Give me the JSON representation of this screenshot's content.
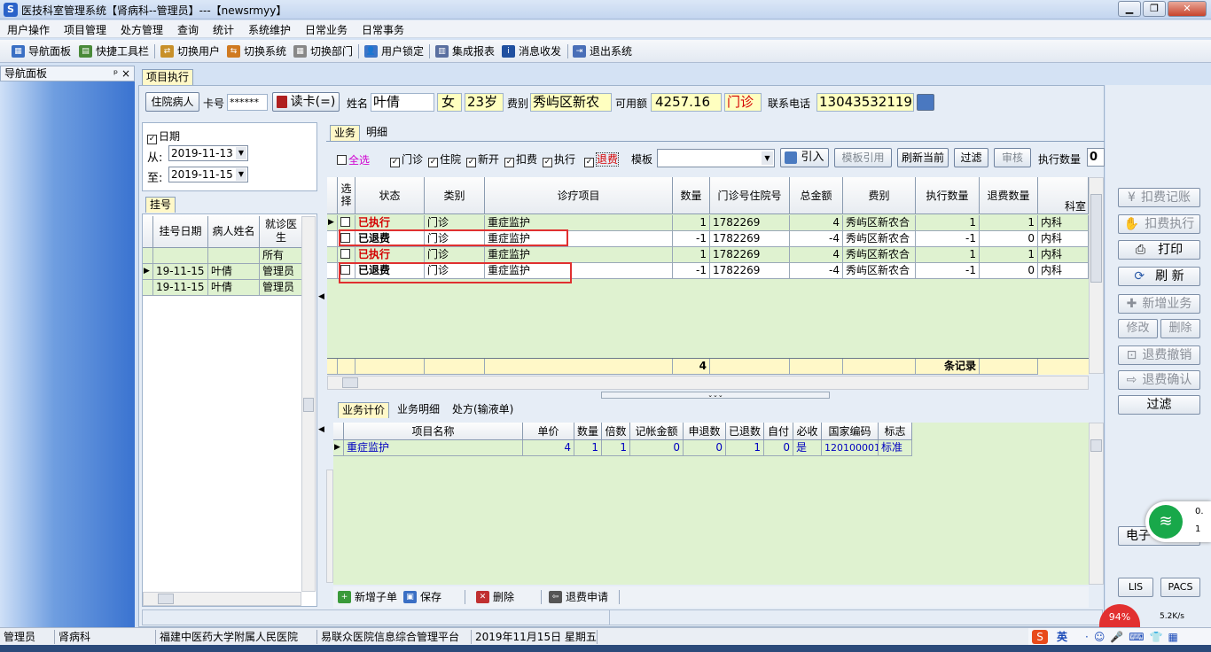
{
  "window": {
    "title": "医技科室管理系统【肾病科--管理员】---【newsrmyy】",
    "logo": "S"
  },
  "menu": [
    "用户操作",
    "项目管理",
    "处方管理",
    "查询",
    "统计",
    "系统维护",
    "日常业务",
    "日常事务"
  ],
  "toolbar": [
    "导航面板",
    "快捷工具栏",
    "切换用户",
    "切换系统",
    "切换部门",
    "用户锁定",
    "集成报表",
    "消息收发",
    "退出系统"
  ],
  "nav": {
    "title": "导航面板",
    "pin": "ᵖ ×"
  },
  "doc_tab": "项目执行",
  "patient": {
    "inpatient_btn": "住院病人",
    "card_label": "卡号",
    "card_value": "******",
    "read_card": "读卡(=)",
    "name_label": "姓名",
    "name": "叶倩",
    "sex": "女",
    "age": "23岁",
    "fee_label": "费别",
    "fee_type": "秀屿区新农",
    "avail_label": "可用额",
    "avail": "4257.16",
    "visit_type": "门诊",
    "phone_label": "联系电话",
    "phone": "13043532119"
  },
  "date_filter": {
    "label": "日期",
    "from_label": "从:",
    "from": "2019-11-13",
    "to_label": "至:",
    "to": "2019-11-15"
  },
  "register": {
    "tab": "挂号",
    "headers": [
      "挂号日期",
      "病人姓名",
      "就诊医生"
    ],
    "all": "所有",
    "rows": [
      [
        "19-11-15",
        "叶倩",
        "管理员"
      ],
      [
        "19-11-15",
        "叶倩",
        "管理员"
      ]
    ]
  },
  "biz_tabs": [
    "业务",
    "明细"
  ],
  "filters": {
    "select_all": "全选",
    "outpatient": "门诊",
    "inpatient": "住院",
    "new": "新开",
    "charge": "扣费",
    "execute": "执行",
    "refund": "退费",
    "template_label": "模板",
    "import": "引入",
    "template_ref": "模板引用",
    "refresh_current": "刷新当前",
    "filter": "过滤",
    "audit": "审核",
    "exec_count_label": "执行数量",
    "exec_count": "0"
  },
  "main_table": {
    "headers": [
      "选择",
      "状态",
      "类别",
      "诊疗项目",
      "数量",
      "门诊号住院号",
      "总金额",
      "费别",
      "执行数量",
      "退费数量",
      "科室"
    ],
    "rows": [
      {
        "status": "已执行",
        "cat": "门诊",
        "item": "重症监护",
        "qty": "1",
        "no": "1782269",
        "amt": "4",
        "fee": "秀屿区新农合",
        "exec": "1",
        "refund": "1",
        "dept": "内科"
      },
      {
        "status": "已退费",
        "cat": "门诊",
        "item": "重症监护",
        "qty": "-1",
        "no": "1782269",
        "amt": "-4",
        "fee": "秀屿区新农合",
        "exec": "-1",
        "refund": "0",
        "dept": "内科"
      },
      {
        "status": "已执行",
        "cat": "门诊",
        "item": "重症监护",
        "qty": "1",
        "no": "1782269",
        "amt": "4",
        "fee": "秀屿区新农合",
        "exec": "1",
        "refund": "1",
        "dept": "内科"
      },
      {
        "status": "已退费",
        "cat": "门诊",
        "item": "重症监护",
        "qty": "-1",
        "no": "1782269",
        "amt": "-4",
        "fee": "秀屿区新农合",
        "exec": "-1",
        "refund": "0",
        "dept": "内科"
      }
    ],
    "footer_count": "4",
    "footer_label": "条记录"
  },
  "detail_tabs": [
    "业务计价",
    "业务明细",
    "处方(输液单)"
  ],
  "detail_table": {
    "headers": [
      "项目名称",
      "单价",
      "数量",
      "倍数",
      "记帐金额",
      "申退数",
      "已退数",
      "自付",
      "必收",
      "国家编码",
      "标志"
    ],
    "row": [
      "重症监护",
      "4",
      "1",
      "1",
      "0",
      "0",
      "1",
      "0",
      "是",
      "120100001",
      "标准"
    ]
  },
  "bottom_actions": [
    "新增子单",
    "保存",
    "删除",
    "退费申请"
  ],
  "right_buttons": [
    "扣费记账",
    "扣费执行",
    "打印",
    "刷 新",
    "新增业务",
    "修改",
    "删除",
    "退费撤销",
    "退费确认",
    "过滤"
  ],
  "right_bottom": {
    "e": "电子",
    "lis": "LIS",
    "pacs": "PACS"
  },
  "net": {
    "up": "0.",
    "down": "1",
    "speed": "5.2K/s",
    "pct": "94%"
  },
  "ime": {
    "lang": "英"
  },
  "status": [
    "管理员",
    "肾病科",
    "福建中医药大学附属人民医院",
    "易联众医院信息综合管理平台",
    "2019年11月15日 星期五"
  ]
}
